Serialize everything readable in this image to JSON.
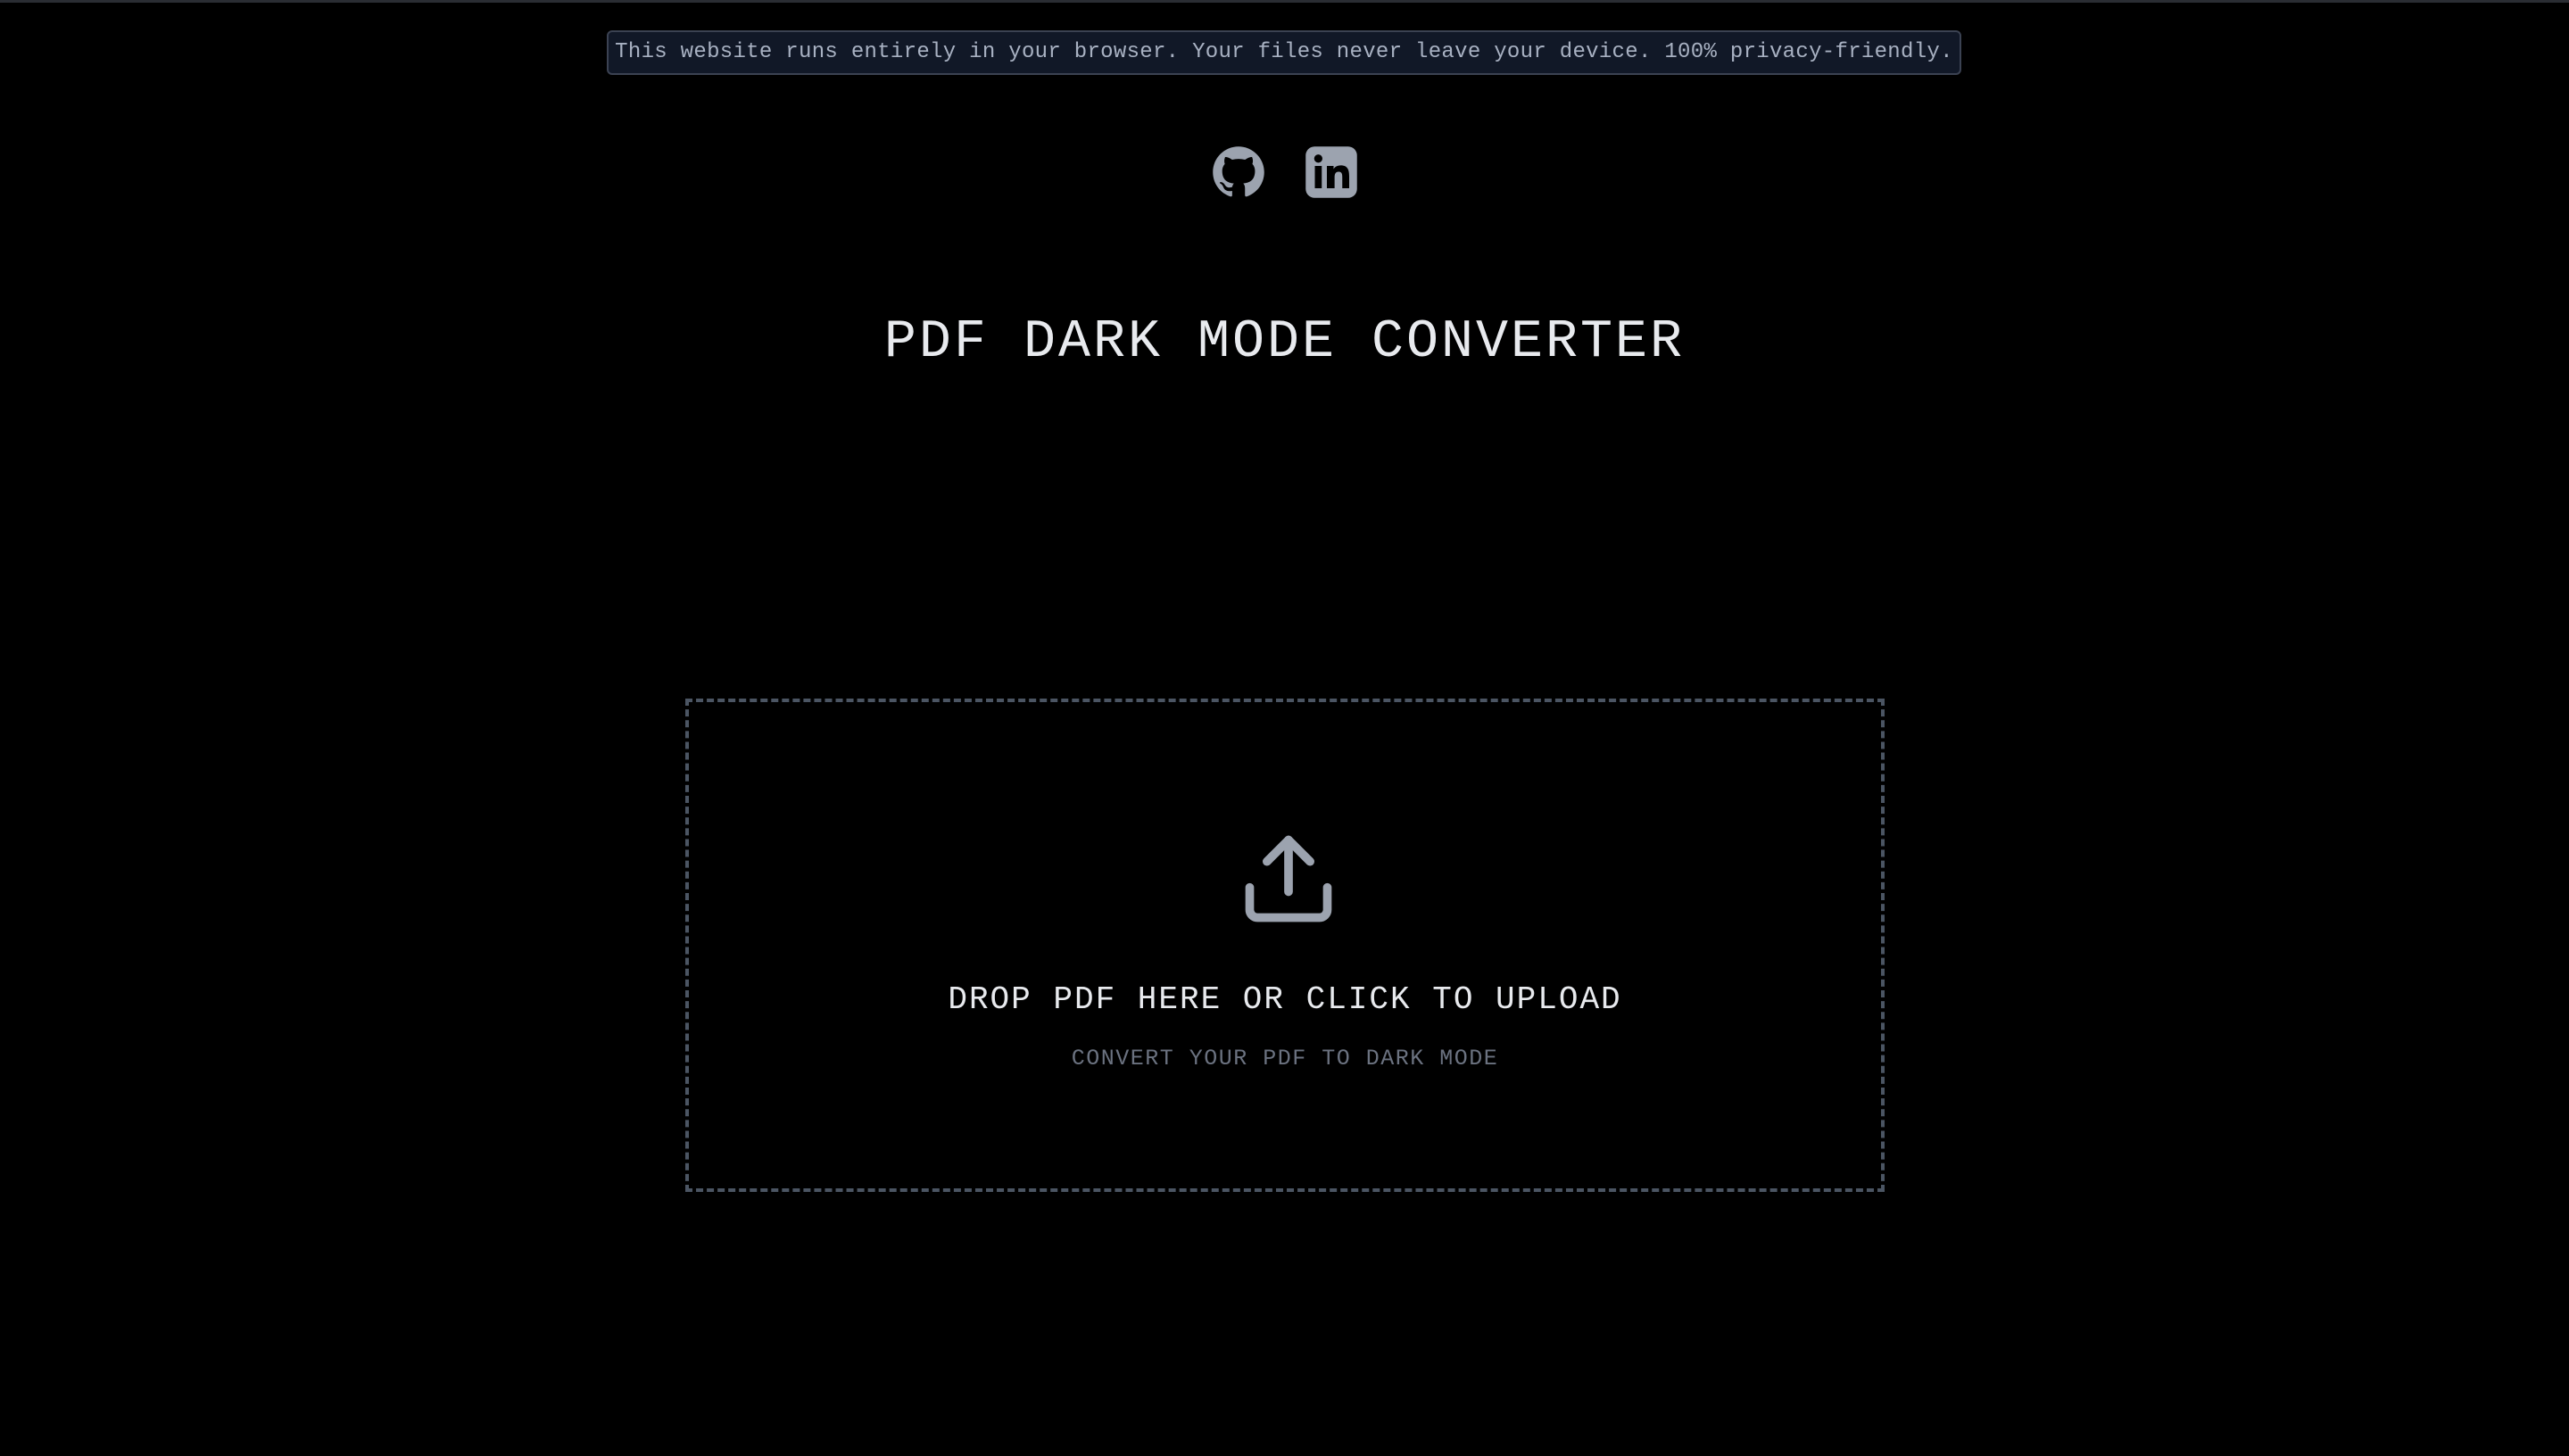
{
  "banner": {
    "text": "This website runs entirely in your browser. Your files never leave your device. 100% privacy-friendly."
  },
  "social": {
    "github_icon": "github-icon",
    "linkedin_icon": "linkedin-icon",
    "icon_color": "#9ca3af"
  },
  "header": {
    "title": "PDF DARK MODE CONVERTER"
  },
  "dropzone": {
    "icon": "upload-icon",
    "primary_text": "DROP PDF HERE OR CLICK TO UPLOAD",
    "secondary_text": "CONVERT YOUR PDF TO DARK MODE"
  },
  "colors": {
    "background": "#000000",
    "banner_background": "#111827",
    "banner_border": "#3b4252",
    "dropzone_border": "#4b5563",
    "muted_text": "#6b7280"
  }
}
